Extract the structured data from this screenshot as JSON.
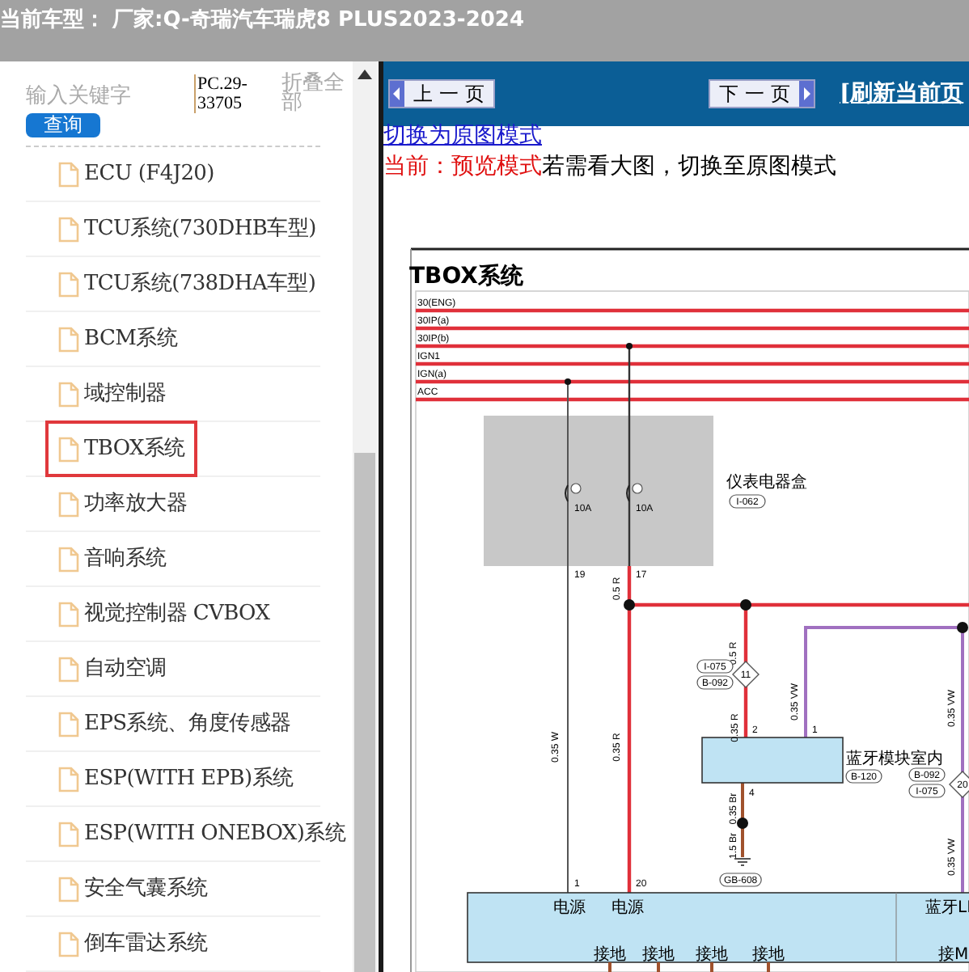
{
  "header": {
    "title": "当前车型： 厂家:Q-奇瑞汽车瑞虎8 PLUS2023-2024"
  },
  "sidebar": {
    "search": {
      "placeholder": "输入关键字"
    },
    "search_button": "查询",
    "code": "PC.29-33705",
    "collapse_all": "折叠全部",
    "items": [
      {
        "label": "ECU (F4J20)",
        "selected": false
      },
      {
        "label": "TCU系统(730DHB车型)",
        "selected": false
      },
      {
        "label": "TCU系统(738DHA车型)",
        "selected": false
      },
      {
        "label": "BCM系统",
        "selected": false
      },
      {
        "label": "域控制器",
        "selected": false
      },
      {
        "label": "TBOX系统",
        "selected": true
      },
      {
        "label": "功率放大器",
        "selected": false
      },
      {
        "label": "音响系统",
        "selected": false
      },
      {
        "label": "视觉控制器 CVBOX",
        "selected": false
      },
      {
        "label": "自动空调",
        "selected": false
      },
      {
        "label": "EPS系统、角度传感器",
        "selected": false
      },
      {
        "label": "ESP(WITH EPB)系统",
        "selected": false
      },
      {
        "label": "ESP(WITH ONEBOX)系统",
        "selected": false
      },
      {
        "label": "安全气囊系统",
        "selected": false
      },
      {
        "label": "倒车雷达系统",
        "selected": false
      }
    ]
  },
  "toolbar": {
    "prev_button": "上 一 页",
    "next_button": "下 一 页",
    "refresh_link": "[刷新当前页"
  },
  "view": {
    "switch_link": "切换为原图模式",
    "mode": "当前：预览模式",
    "hint": "若需看大图，切换至原图模式"
  },
  "diagram": {
    "title": "TBOX系统",
    "buses": [
      "30(ENG)",
      "30IP(a)",
      "30IP(b)",
      "IGN1",
      "IGN(a)",
      "ACC"
    ],
    "labels": [
      {
        "kind": "cjk",
        "text": "仪表电器盒"
      },
      {
        "kind": "tag",
        "text": "I-062"
      },
      {
        "kind": "text",
        "text": "10A"
      },
      {
        "kind": "text",
        "text": "10A"
      },
      {
        "kind": "text",
        "text": "19"
      },
      {
        "kind": "text",
        "text": "17"
      },
      {
        "kind": "rot",
        "text": "0.5 R"
      },
      {
        "kind": "rot",
        "text": "0.5 R"
      },
      {
        "kind": "tag",
        "text": "I-075"
      },
      {
        "kind": "tag",
        "text": "B-092"
      },
      {
        "kind": "diamond",
        "text": "11"
      },
      {
        "kind": "rot",
        "text": "0.35 VW"
      },
      {
        "kind": "rot",
        "text": "0.35 VW"
      },
      {
        "kind": "rot",
        "text": "0.35 W"
      },
      {
        "kind": "rot",
        "text": "0.35 R"
      },
      {
        "kind": "rot",
        "text": "0.35 R"
      },
      {
        "kind": "text",
        "text": "2"
      },
      {
        "kind": "text",
        "text": "1"
      },
      {
        "kind": "cjk",
        "text": "蓝牙模块室内"
      },
      {
        "kind": "tag",
        "text": "B-120"
      },
      {
        "kind": "tag",
        "text": "B-092"
      },
      {
        "kind": "tag",
        "text": "I-075"
      },
      {
        "kind": "diamond",
        "text": "20"
      },
      {
        "kind": "text",
        "text": "4"
      },
      {
        "kind": "rot",
        "text": "0.35 Br"
      },
      {
        "kind": "rot",
        "text": "1.5 Br"
      },
      {
        "kind": "rot",
        "text": "0.35 VW"
      },
      {
        "kind": "text",
        "text": "1"
      },
      {
        "kind": "text",
        "text": "20"
      },
      {
        "kind": "tag",
        "text": "GB-608"
      },
      {
        "kind": "cjk",
        "text": "电源"
      },
      {
        "kind": "cjk",
        "text": "电源"
      },
      {
        "kind": "cjk",
        "text": "蓝牙LI"
      },
      {
        "kind": "cjk",
        "text": "接地"
      },
      {
        "kind": "cjk",
        "text": "接地"
      },
      {
        "kind": "cjk",
        "text": "接地"
      },
      {
        "kind": "cjk",
        "text": "接地"
      },
      {
        "kind": "cjk",
        "text": "接M"
      }
    ]
  }
}
